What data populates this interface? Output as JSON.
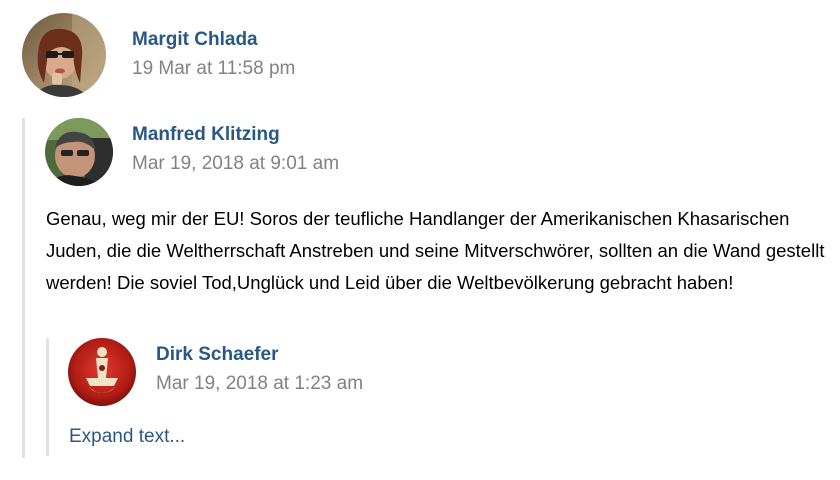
{
  "colors": {
    "name_link": "#2a5885",
    "date_gray": "#828282",
    "thread_line": "#dfe3e8",
    "text": "#000000"
  },
  "posts": [
    {
      "author": "Margit Chlada",
      "date": "19 Mar at 11:58 pm"
    },
    {
      "author": "Manfred Klitzing",
      "date": "Mar 19, 2018 at 9:01 am",
      "text": "Genau, weg mir der EU! Soros der teufliche Handlanger der Amerikanischen Khasarischen Juden, die die Weltherrschaft Anstreben und seine Mitverschwörer, sollten an die Wand gestellt werden! Die soviel Tod,Unglück und Leid über die Weltbevölkerung gebracht haben!"
    },
    {
      "author": "Dirk Schaefer",
      "date": "Mar 19, 2018 at 1:23 am",
      "expand_label": "Expand text..."
    }
  ]
}
